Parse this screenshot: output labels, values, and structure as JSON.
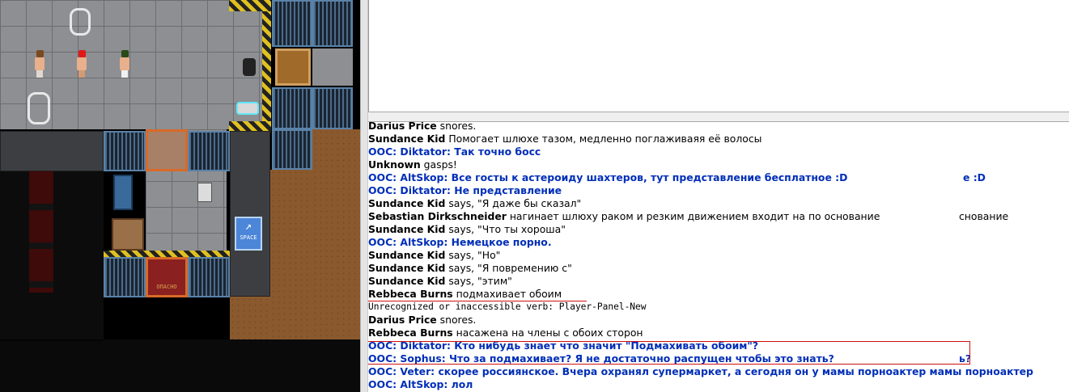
{
  "game": {
    "sign_text": "SPACE",
    "door_label": "ОПАСНО"
  },
  "chat": {
    "lines": [
      {
        "type": "emote",
        "speaker": "Darius Price",
        "text": " snores."
      },
      {
        "type": "emote",
        "speaker": "Sundance Kid",
        "text": " Помогает шлюхе тазом, медленно поглаживаяя её волосы"
      },
      {
        "type": "ooc",
        "text": "OOC: Diktator: Так точно босс"
      },
      {
        "type": "emote",
        "speaker": "Unknown",
        "text": " gasps!"
      },
      {
        "type": "ooc",
        "text": "OOC: AltSkop: Все госты к астероиду шахтеров, тут представление бесплатное :D"
      },
      {
        "type": "ooc",
        "text": "OOC: Diktator: Не представление"
      },
      {
        "type": "emote",
        "speaker": "Sundance Kid",
        "text": " says, \"Я даже бы сказал\""
      },
      {
        "type": "emote",
        "speaker": "Sebastian Dirkschneider",
        "text": " нагинает шлюху раком и резким движением входит на по основание"
      },
      {
        "type": "emote",
        "speaker": "Sundance Kid",
        "text": " says, \"Что ты хороша\""
      },
      {
        "type": "ooc",
        "text": "OOC: AltSkop: Немецкое порно."
      },
      {
        "type": "emote",
        "speaker": "Sundance Kid",
        "text": " says, \"Но\""
      },
      {
        "type": "emote",
        "speaker": "Sundance Kid",
        "text": " says, \"Я повремению с\""
      },
      {
        "type": "emote",
        "speaker": "Sundance Kid",
        "text": " says, \"этим\""
      },
      {
        "type": "emote",
        "speaker": "Rebbeca Burns",
        "text": " подмахивает обоим"
      },
      {
        "type": "sys",
        "text": "Unrecognized or inaccessible verb: Player-Panel-New"
      },
      {
        "type": "emote",
        "speaker": "Darius Price",
        "text": " snores."
      },
      {
        "type": "emote",
        "speaker": "Rebbeca Burns",
        "text": " насажена на члены с обоих сторон"
      },
      {
        "type": "ooc",
        "text": "OOC: Diktator: Кто нибудь знает что значит \"Подмахивать обоим\"?"
      },
      {
        "type": "ooc",
        "text": "OOC: Sophus: Что за подмахивает? Я не достаточно распущен чтобы это знать?"
      },
      {
        "type": "ooc",
        "text": "OOC: Veter: скорее россиянское. Вчера охранял супермаркет, а сегодня он у мамы порноактер мамы порноактер"
      },
      {
        "type": "ooc",
        "text": "OOC: AltSkop: лол"
      }
    ],
    "overlap_fragments": [
      {
        "text": "е :D",
        "line": 4
      },
      {
        "text": "снование",
        "line": 7
      },
      {
        "text": "ь?",
        "line": 18
      }
    ]
  },
  "colors": {
    "ooc": "#002eb8",
    "annotation": "#d01010"
  }
}
